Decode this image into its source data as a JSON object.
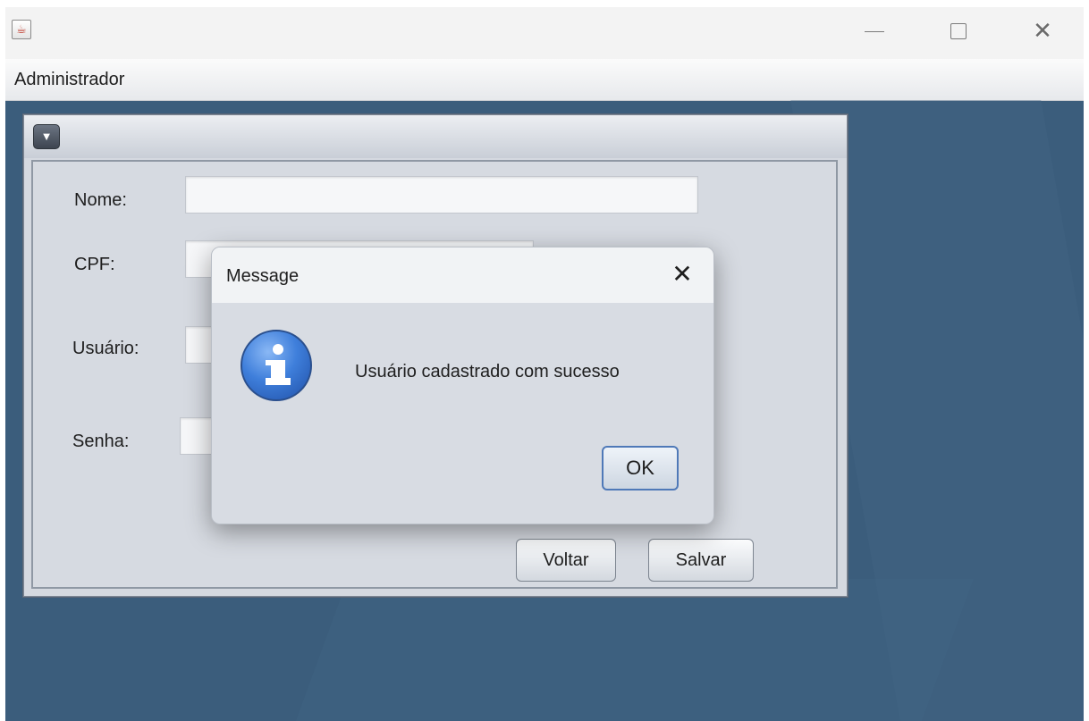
{
  "window": {
    "app_icon": "java-cup-icon",
    "close_symbol": "✕"
  },
  "menubar": {
    "items": [
      {
        "label": "Administrador"
      }
    ]
  },
  "internal_frame": {
    "menu_icon": "dropdown-triangle-icon"
  },
  "form": {
    "nome_label": "Nome:",
    "cpf_label": "CPF:",
    "usuario_label": "Usuário:",
    "senha_label": "Senha:",
    "nome_value": "",
    "cpf_value": "",
    "usuario_value": "",
    "senha_value": ""
  },
  "buttons": {
    "voltar": "Voltar",
    "salvar": "Salvar"
  },
  "dialog": {
    "title": "Message",
    "message": "Usuário cadastrado com sucesso",
    "ok": "OK",
    "icon": "info-icon",
    "close_symbol": "✕"
  }
}
